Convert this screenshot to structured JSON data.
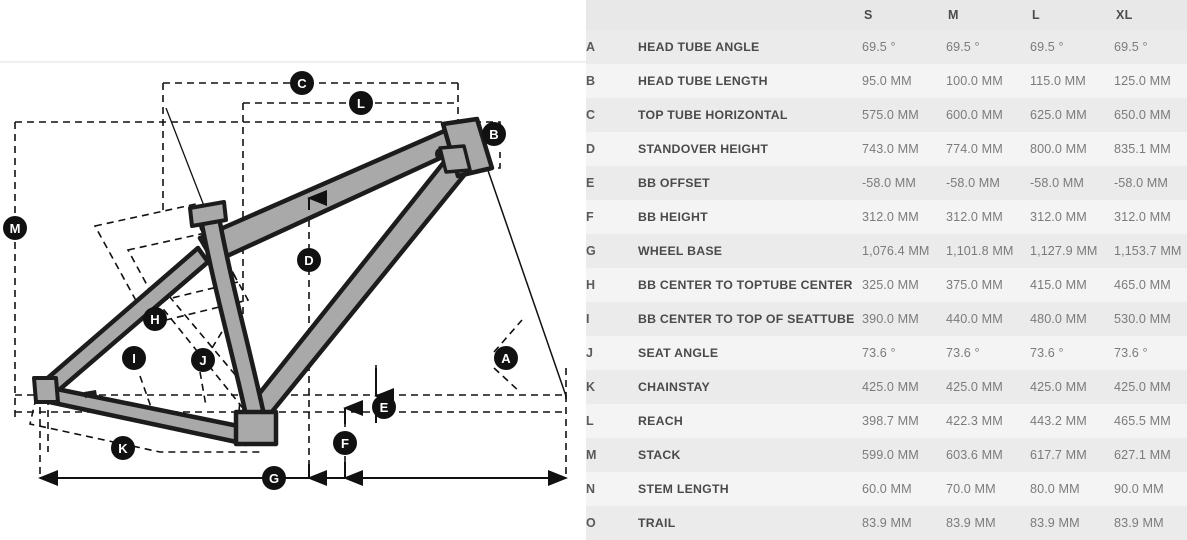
{
  "table": {
    "columns": [
      "",
      "",
      "S",
      "M",
      "L",
      "XL"
    ],
    "headers": {
      "size_s": "S",
      "size_m": "M",
      "size_l": "L",
      "size_xl": "XL"
    },
    "rows": [
      {
        "letter": "A",
        "name": "HEAD TUBE ANGLE",
        "s": "69.5 °",
        "m": "69.5 °",
        "l": "69.5 °",
        "xl": "69.5 °"
      },
      {
        "letter": "B",
        "name": "HEAD TUBE LENGTH",
        "s": "95.0 MM",
        "m": "100.0 MM",
        "l": "115.0 MM",
        "xl": "125.0 MM"
      },
      {
        "letter": "C",
        "name": "TOP TUBE HORIZONTAL",
        "s": "575.0 MM",
        "m": "600.0 MM",
        "l": "625.0 MM",
        "xl": "650.0 MM"
      },
      {
        "letter": "D",
        "name": "STANDOVER HEIGHT",
        "s": "743.0 MM",
        "m": "774.0 MM",
        "l": "800.0 MM",
        "xl": "835.1 MM"
      },
      {
        "letter": "E",
        "name": "BB OFFSET",
        "s": "-58.0 MM",
        "m": "-58.0 MM",
        "l": "-58.0 MM",
        "xl": "-58.0 MM"
      },
      {
        "letter": "F",
        "name": "BB HEIGHT",
        "s": "312.0 MM",
        "m": "312.0 MM",
        "l": "312.0 MM",
        "xl": "312.0 MM"
      },
      {
        "letter": "G",
        "name": "WHEEL BASE",
        "s": "1,076.4 MM",
        "m": "1,101.8 MM",
        "l": "1,127.9 MM",
        "xl": "1,153.7 MM"
      },
      {
        "letter": "H",
        "name": "BB CENTER TO TOPTUBE CENTER",
        "s": "325.0 MM",
        "m": "375.0 MM",
        "l": "415.0 MM",
        "xl": "465.0 MM"
      },
      {
        "letter": "I",
        "name": "BB CENTER TO TOP OF SEATTUBE",
        "s": "390.0 MM",
        "m": "440.0 MM",
        "l": "480.0 MM",
        "xl": "530.0 MM"
      },
      {
        "letter": "J",
        "name": "SEAT ANGLE",
        "s": "73.6 °",
        "m": "73.6 °",
        "l": "73.6 °",
        "xl": "73.6 °"
      },
      {
        "letter": "K",
        "name": "CHAINSTAY",
        "s": "425.0 MM",
        "m": "425.0 MM",
        "l": "425.0 MM",
        "xl": "425.0 MM"
      },
      {
        "letter": "L",
        "name": "REACH",
        "s": "398.7 MM",
        "m": "422.3 MM",
        "l": "443.2 MM",
        "xl": "465.5 MM"
      },
      {
        "letter": "M",
        "name": "STACK",
        "s": "599.0 MM",
        "m": "603.6 MM",
        "l": "617.7 MM",
        "xl": "627.1 MM"
      },
      {
        "letter": "N",
        "name": "STEM LENGTH",
        "s": "60.0 MM",
        "m": "70.0 MM",
        "l": "80.0 MM",
        "xl": "90.0 MM"
      },
      {
        "letter": "O",
        "name": "TRAIL",
        "s": "83.9 MM",
        "m": "83.9 MM",
        "l": "83.9 MM",
        "xl": "83.9 MM"
      }
    ]
  },
  "diagram": {
    "callouts": {
      "a": "A",
      "b": "B",
      "c": "C",
      "d": "D",
      "e": "E",
      "f": "F",
      "g": "G",
      "h": "H",
      "i": "I",
      "j": "J",
      "k": "K",
      "l": "L",
      "m": "M"
    }
  },
  "colors": {
    "frame_fill": "#a9a9a9",
    "frame_stroke": "#1c1c1c",
    "bubble_fill": "#111111",
    "bubble_text": "#ffffff",
    "dash_line": "#111111",
    "row_odd": "#ebebeb",
    "row_even": "#f4f4f4",
    "header_bg": "#e8e8e8",
    "label_text": "#4a4a4a",
    "value_text": "#7b7b7b"
  }
}
